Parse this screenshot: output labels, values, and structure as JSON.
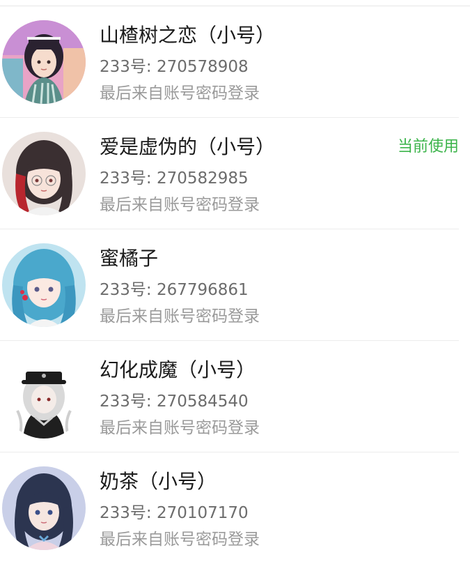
{
  "accounts": [
    {
      "nickname": "山楂树之恋（小号）",
      "id_text": "233号: 270578908",
      "login_method": "最后来自账号密码登录",
      "current_label": ""
    },
    {
      "nickname": "爱是虚伪的（小号）",
      "id_text": "233号: 270582985",
      "login_method": "最后来自账号密码登录",
      "current_label": "当前使用"
    },
    {
      "nickname": "蜜橘子",
      "id_text": "233号: 267796861",
      "login_method": "最后来自账号密码登录",
      "current_label": ""
    },
    {
      "nickname": "幻化成魔（小号）",
      "id_text": "233号: 270584540",
      "login_method": "最后来自账号密码登录",
      "current_label": ""
    },
    {
      "nickname": "奶茶（小号）",
      "id_text": "233号: 270107170",
      "login_method": "最后来自账号密码登录",
      "current_label": ""
    }
  ],
  "colors": {
    "current_badge": "#3cb44b",
    "nickname": "#1b1b1b",
    "id_text": "#6c6c6c",
    "secondary_text": "#9a9a9a"
  }
}
